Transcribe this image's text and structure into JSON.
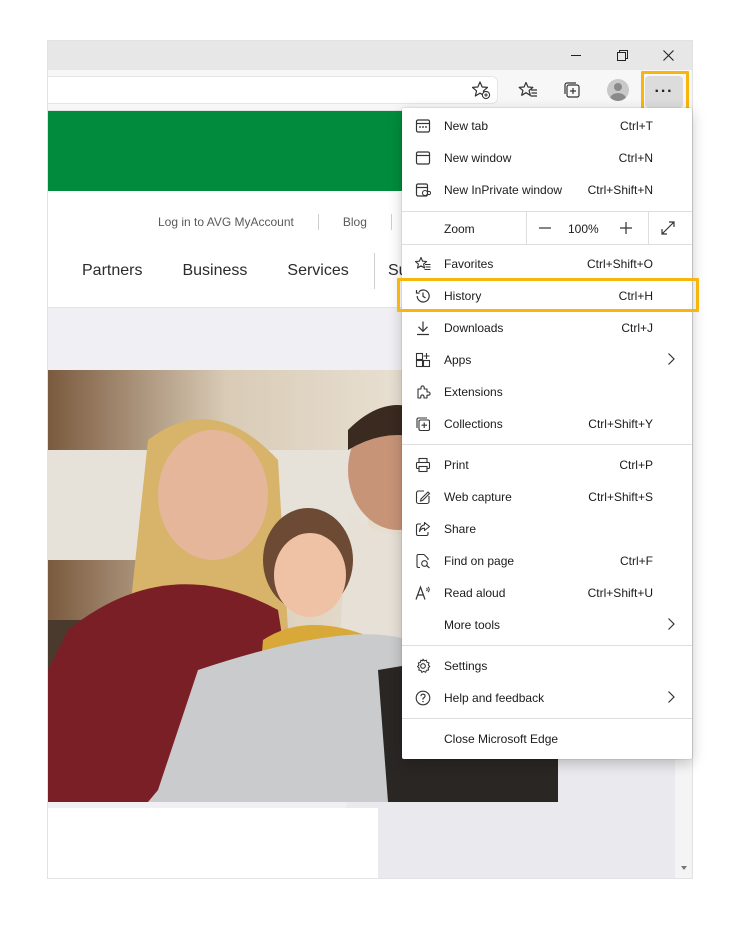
{
  "window": {
    "minimize_icon": "minimize-icon",
    "restore_icon": "restore-icon",
    "close_icon": "close-icon"
  },
  "toolbar": {
    "address_value": "",
    "icons": [
      "add-favorite-icon",
      "favorites-icon",
      "collections-icon",
      "profile-icon",
      "more-icon"
    ],
    "more_label": "···"
  },
  "page": {
    "util_links": [
      "Log in to AVG MyAccount",
      "Blog"
    ],
    "nav": [
      "Partners",
      "Business",
      "Services"
    ],
    "nav_truncated": "Su",
    "brand_color": "#008c3c"
  },
  "menu": {
    "items": [
      {
        "label": "New tab",
        "shortcut": "Ctrl+T",
        "icon": "new-tab-icon"
      },
      {
        "label": "New window",
        "shortcut": "Ctrl+N",
        "icon": "new-window-icon"
      },
      {
        "label": "New InPrivate window",
        "shortcut": "Ctrl+Shift+N",
        "icon": "inprivate-icon"
      },
      {
        "label": "Favorites",
        "shortcut": "Ctrl+Shift+O",
        "icon": "favorites-icon"
      },
      {
        "label": "History",
        "shortcut": "Ctrl+H",
        "icon": "history-icon"
      },
      {
        "label": "Downloads",
        "shortcut": "Ctrl+J",
        "icon": "download-icon"
      },
      {
        "label": "Apps",
        "shortcut": "",
        "icon": "apps-icon"
      },
      {
        "label": "Extensions",
        "shortcut": "",
        "icon": "extensions-icon"
      },
      {
        "label": "Collections",
        "shortcut": "Ctrl+Shift+Y",
        "icon": "collections-icon"
      },
      {
        "label": "Print",
        "shortcut": "Ctrl+P",
        "icon": "print-icon"
      },
      {
        "label": "Web capture",
        "shortcut": "Ctrl+Shift+S",
        "icon": "web-capture-icon"
      },
      {
        "label": "Share",
        "shortcut": "",
        "icon": "share-icon"
      },
      {
        "label": "Find on page",
        "shortcut": "Ctrl+F",
        "icon": "find-icon"
      },
      {
        "label": "Read aloud",
        "shortcut": "Ctrl+Shift+U",
        "icon": "read-aloud-icon"
      },
      {
        "label": "More tools",
        "shortcut": "",
        "icon": ""
      },
      {
        "label": "Settings",
        "shortcut": "",
        "icon": "gear-icon"
      },
      {
        "label": "Help and feedback",
        "shortcut": "",
        "icon": "help-icon"
      },
      {
        "label": "Close Microsoft Edge",
        "shortcut": "",
        "icon": ""
      }
    ],
    "zoom": {
      "label": "Zoom",
      "minus": "—",
      "value": "100%",
      "plus": "+"
    }
  },
  "highlight_color": "#f6b60e"
}
